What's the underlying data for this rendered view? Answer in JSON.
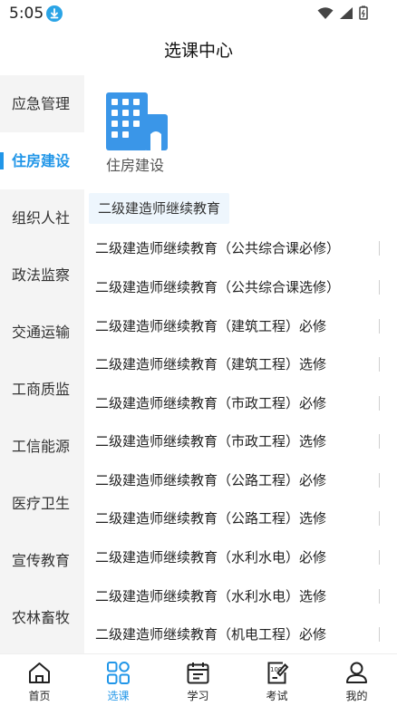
{
  "status_bar": {
    "time": "5:05"
  },
  "header": {
    "title": "选课中心"
  },
  "sidebar": {
    "items": [
      {
        "label": "应急管理"
      },
      {
        "label": "住房建设"
      },
      {
        "label": "组织人社"
      },
      {
        "label": "政法监察"
      },
      {
        "label": "交通运输"
      },
      {
        "label": "工商质监"
      },
      {
        "label": "工信能源"
      },
      {
        "label": "医疗卫生"
      },
      {
        "label": "宣传教育"
      },
      {
        "label": "农林畜牧"
      }
    ],
    "active_index": 1
  },
  "category": {
    "title": "住房建设",
    "icon": "building-icon",
    "sub_header": "二级建造师继续教育",
    "courses": [
      "二级建造师继续教育（公共综合课必修）",
      "二级建造师继续教育（公共综合课选修）",
      "二级建造师继续教育（建筑工程）必修",
      "二级建造师继续教育（建筑工程）选修",
      "二级建造师继续教育（市政工程）必修",
      "二级建造师继续教育（市政工程）选修",
      "二级建造师继续教育（公路工程）必修",
      "二级建造师继续教育（公路工程）选修",
      "二级建造师继续教育（水利水电）必修",
      "二级建造师继续教育（水利水电）选修",
      "二级建造师继续教育（机电工程）必修"
    ]
  },
  "bottom_nav": {
    "items": [
      {
        "label": "首页",
        "icon": "home-icon"
      },
      {
        "label": "选课",
        "icon": "grid-icon"
      },
      {
        "label": "学习",
        "icon": "calendar-icon"
      },
      {
        "label": "考试",
        "icon": "exam-icon"
      },
      {
        "label": "我的",
        "icon": "user-icon"
      }
    ],
    "active_index": 1
  },
  "colors": {
    "accent": "#2196e8",
    "sidebar_bg": "#f4f4f4",
    "sub_header_bg": "#eef6fd"
  }
}
